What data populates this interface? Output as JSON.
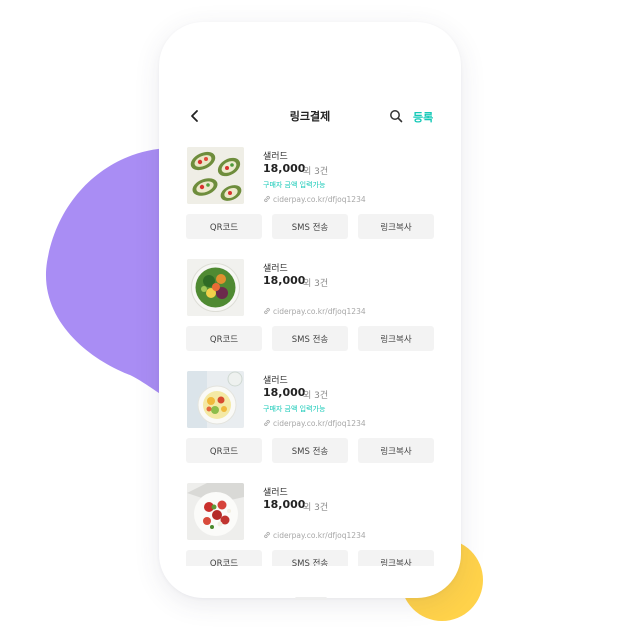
{
  "header": {
    "title": "링크결제",
    "register_label": "등록",
    "back_icon": "back-arrow-icon",
    "search_icon": "search-icon"
  },
  "colors": {
    "accent": "#14c9b7",
    "blob_purple": "#a98df4",
    "blob_yellow": "#ffd24a"
  },
  "products": [
    {
      "name": "샐러드",
      "price": "18,000",
      "count": "외 3건",
      "note": "구매자 금액 입력가능",
      "url": "ciderpay.co.kr/dfjoq1234",
      "buttons": {
        "qr": "QR코드",
        "sms": "SMS 전송",
        "copy": "링크복사"
      }
    },
    {
      "name": "샐러드",
      "price": "18,000",
      "count": "외 3건",
      "note": "",
      "url": "ciderpay.co.kr/dfjoq1234",
      "buttons": {
        "qr": "QR코드",
        "sms": "SMS 전송",
        "copy": "링크복사"
      }
    },
    {
      "name": "샐러드",
      "price": "18,000",
      "count": "외 3건",
      "note": "구매자 금액 입력가능",
      "url": "ciderpay.co.kr/dfjoq1234",
      "buttons": {
        "qr": "QR코드",
        "sms": "SMS 전송",
        "copy": "링크복사"
      }
    },
    {
      "name": "샐러드",
      "price": "18,000",
      "count": "외 3건",
      "note": "",
      "url": "ciderpay.co.kr/dfjoq1234",
      "buttons": {
        "qr": "QR코드",
        "sms": "SMS 전송",
        "copy": "링크복사"
      }
    }
  ]
}
